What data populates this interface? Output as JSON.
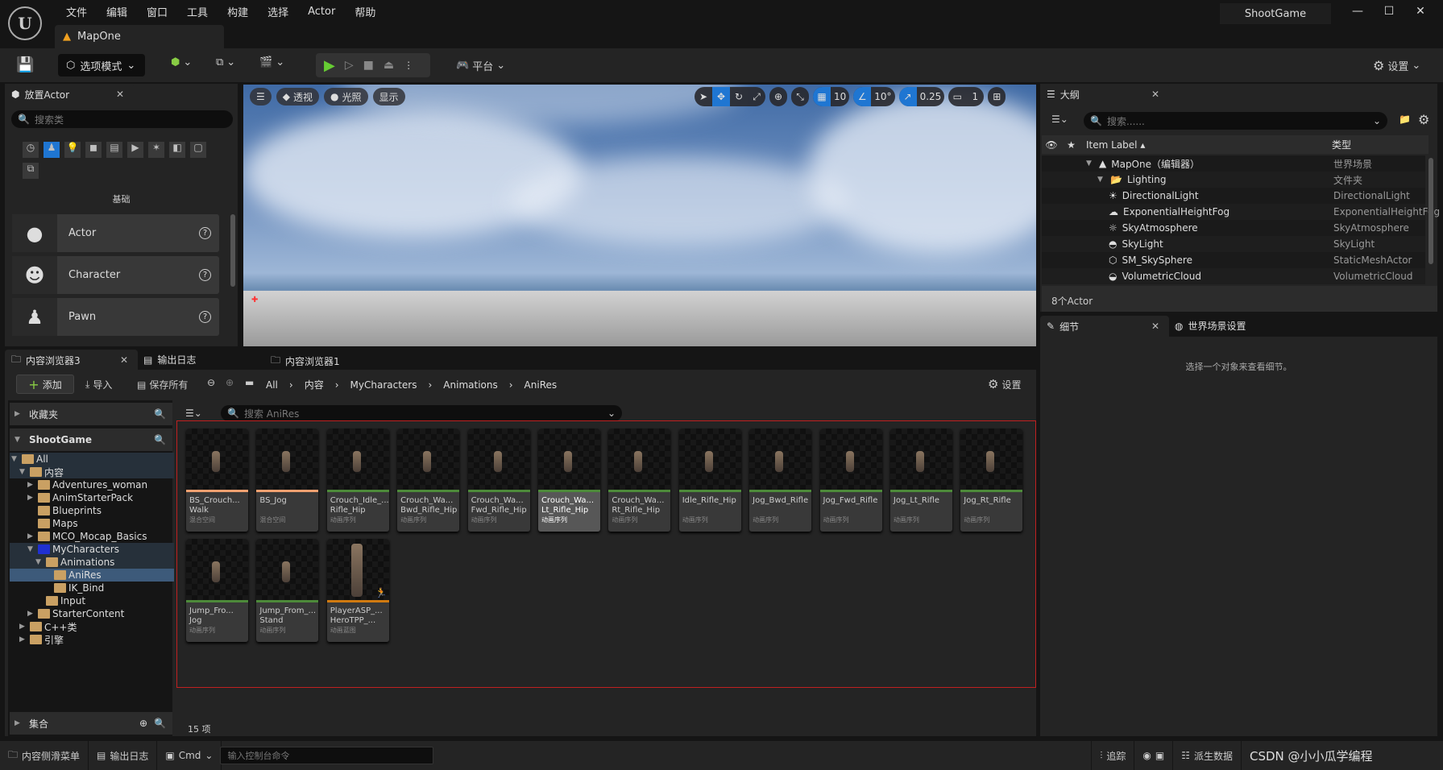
{
  "app": {
    "logo": "U",
    "menu": [
      "文件",
      "编辑",
      "窗口",
      "工具",
      "构建",
      "选择",
      "Actor",
      "帮助"
    ],
    "tab": "MapOne",
    "project": "ShootGame"
  },
  "toolbar": {
    "mode": "选项模式",
    "platform": "平台",
    "settings": "设置"
  },
  "place_actor": {
    "title": "放置Actor",
    "search_placeholder": "搜索类",
    "category": "基础",
    "items": [
      {
        "label": "Actor",
        "icon": "sphere-icon"
      },
      {
        "label": "Character",
        "icon": "character-icon"
      },
      {
        "label": "Pawn",
        "icon": "pawn-icon"
      }
    ]
  },
  "viewport": {
    "perspective": "透视",
    "lighting": "光照",
    "show": "显示",
    "grid_snap": "10",
    "rotate_snap": "10°",
    "scale_snap": "0.25",
    "camera_speed": "1"
  },
  "outliner": {
    "title": "大纲",
    "search_placeholder": "搜索......",
    "col_label": "Item Label",
    "col_type": "类型",
    "rows": [
      {
        "label": "MapOne（编辑器）",
        "type": "世界场景",
        "indent": 0,
        "icon": "level-icon"
      },
      {
        "label": "Lighting",
        "type": "文件夹",
        "indent": 1,
        "icon": "folder-icon"
      },
      {
        "label": "DirectionalLight",
        "type": "DirectionalLight",
        "indent": 2,
        "icon": "sun-icon"
      },
      {
        "label": "ExponentialHeightFog",
        "type": "ExponentialHeightFog",
        "indent": 2,
        "icon": "fog-icon"
      },
      {
        "label": "SkyAtmosphere",
        "type": "SkyAtmosphere",
        "indent": 2,
        "icon": "sky-icon"
      },
      {
        "label": "SkyLight",
        "type": "SkyLight",
        "indent": 2,
        "icon": "skylight-icon"
      },
      {
        "label": "SM_SkySphere",
        "type": "StaticMeshActor",
        "indent": 2,
        "icon": "mesh-icon"
      },
      {
        "label": "VolumetricCloud",
        "type": "VolumetricCloud",
        "indent": 2,
        "icon": "cloud-icon"
      }
    ],
    "count": "8个Actor"
  },
  "details": {
    "tab1": "细节",
    "tab2": "世界场景设置",
    "empty": "选择一个对象来查看细节。"
  },
  "content_browser": {
    "tabs": [
      "内容浏览器3",
      "输出日志",
      "内容浏览器1"
    ],
    "add": "添加",
    "import": "导入",
    "save_all": "保存所有",
    "breadcrumb": [
      "All",
      "内容",
      "MyCharacters",
      "Animations",
      "AniRes"
    ],
    "settings": "设置",
    "favorites": "收藏夹",
    "project": "ShootGame",
    "collections": "集合",
    "search_placeholder": "搜索 AniRes",
    "item_count": "15 项",
    "tree": [
      {
        "label": "All",
        "depth": 0,
        "open": true,
        "hl": true
      },
      {
        "label": "内容",
        "depth": 1,
        "open": true,
        "hl": true
      },
      {
        "label": "Adventures_woman",
        "depth": 2,
        "arrow": true
      },
      {
        "label": "AnimStarterPack",
        "depth": 2,
        "arrow": true
      },
      {
        "label": "Blueprints",
        "depth": 2
      },
      {
        "label": "Maps",
        "depth": 2
      },
      {
        "label": "MCO_Mocap_Basics",
        "depth": 2,
        "arrow": true
      },
      {
        "label": "MyCharacters",
        "depth": 2,
        "open": true,
        "hl": true,
        "blue": true
      },
      {
        "label": "Animations",
        "depth": 3,
        "open": true,
        "hl": true
      },
      {
        "label": "AniRes",
        "depth": 4,
        "selected": true
      },
      {
        "label": "IK_Bind",
        "depth": 4
      },
      {
        "label": "Input",
        "depth": 3
      },
      {
        "label": "StarterContent",
        "depth": 2,
        "arrow": true
      },
      {
        "label": "C++类",
        "depth": 1,
        "arrow": true
      },
      {
        "label": "引擎",
        "depth": 1,
        "arrow": true
      }
    ],
    "assets": [
      {
        "name": "BS_Crouch...",
        "name2": "Walk",
        "type": "混合空间",
        "color": "#f0a070"
      },
      {
        "name": "BS_Jog",
        "name2": "",
        "type": "混合空间",
        "color": "#f0a070"
      },
      {
        "name": "Crouch_Idle_...",
        "name2": "Rifle_Hip",
        "type": "动画序列",
        "color": "#4d8a3a"
      },
      {
        "name": "Crouch_Wa...",
        "name2": "Bwd_Rifle_Hip",
        "type": "动画序列",
        "color": "#4d8a3a"
      },
      {
        "name": "Crouch_Wa...",
        "name2": "Fwd_Rifle_Hip",
        "type": "动画序列",
        "color": "#4d8a3a"
      },
      {
        "name": "Crouch_Wa...",
        "name2": "Lt_Rifle_Hip",
        "type": "动画序列",
        "color": "#4d8a3a",
        "selected": true
      },
      {
        "name": "Crouch_Wa...",
        "name2": "Rt_Rifle_Hip",
        "type": "动画序列",
        "color": "#4d8a3a"
      },
      {
        "name": "Idle_Rifle_Hip",
        "name2": "",
        "type": "动画序列",
        "color": "#4d8a3a"
      },
      {
        "name": "Jog_Bwd_Rifle",
        "name2": "",
        "type": "动画序列",
        "color": "#4d8a3a"
      },
      {
        "name": "Jog_Fwd_Rifle",
        "name2": "",
        "type": "动画序列",
        "color": "#4d8a3a"
      },
      {
        "name": "Jog_Lt_Rifle",
        "name2": "",
        "type": "动画序列",
        "color": "#4d8a3a"
      },
      {
        "name": "Jog_Rt_Rifle",
        "name2": "",
        "type": "动画序列",
        "color": "#4d8a3a"
      },
      {
        "name": "Jump_Fro...",
        "name2": "Jog",
        "type": "动画序列",
        "color": "#4d8a3a"
      },
      {
        "name": "Jump_From_...",
        "name2": "Stand",
        "type": "动画序列",
        "color": "#4d8a3a"
      },
      {
        "name": "PlayerASP_...",
        "name2": "HeroTPP_...",
        "type": "动画蓝图",
        "color": "#d07a10"
      }
    ]
  },
  "statusbar": {
    "drawer": "内容侧滑菜单",
    "log": "输出日志",
    "cmd": "Cmd",
    "cmd_placeholder": "输入控制台命令",
    "trace": "追踪",
    "derived": "派生数据",
    "watermark": "CSDN @小小瓜学编程"
  }
}
